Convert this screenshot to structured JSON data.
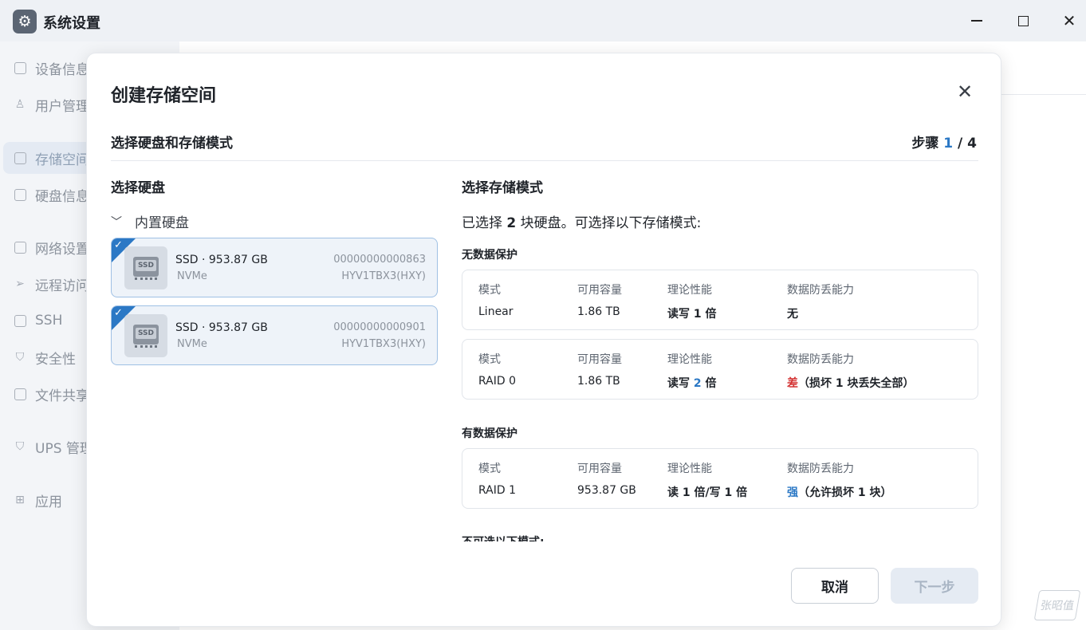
{
  "window": {
    "title": "系统设置",
    "app_icon": "gear-icon",
    "controls": [
      "minimize-icon",
      "maximize-icon",
      "close-icon"
    ]
  },
  "sidebar": {
    "items": [
      {
        "label": "设备信息",
        "icon": "device-icon"
      },
      {
        "label": "用户管理",
        "icon": "user-icon"
      },
      {
        "label": "存储空间",
        "icon": "storage-icon",
        "active": true
      },
      {
        "label": "硬盘信息",
        "icon": "disk-icon"
      },
      {
        "label": "网络设置",
        "icon": "network-icon"
      },
      {
        "label": "远程访问",
        "icon": "send-icon"
      },
      {
        "label": "SSH",
        "icon": "terminal-icon"
      },
      {
        "label": "安全性",
        "icon": "shield-icon"
      },
      {
        "label": "文件共享",
        "icon": "file-icon"
      },
      {
        "label": "UPS 管理",
        "icon": "shield-outline-icon"
      },
      {
        "label": "应用",
        "icon": "apps-grid-icon"
      }
    ]
  },
  "modal": {
    "title": "创建存储空间",
    "step_title": "选择硬盘和存储模式",
    "step_prefix": "步骤 ",
    "step_current": "1",
    "step_suffix": " / 4",
    "left": {
      "heading": "选择硬盘",
      "group_label": "内置硬盘",
      "disks": [
        {
          "name": "SSD · 953.87 GB",
          "type": "NVMe",
          "serial": "00000000000863",
          "model": "HYV1TBX3(HXY)",
          "icon_label": "SSD",
          "selected": true
        },
        {
          "name": "SSD · 953.87 GB",
          "type": "NVMe",
          "serial": "00000000000901",
          "model": "HYV1TBX3(HXY)",
          "icon_label": "SSD",
          "selected": true
        }
      ]
    },
    "right": {
      "heading": "选择存储模式",
      "info_prefix": "已选择 ",
      "info_count": "2",
      "info_suffix": " 块硬盘。可选择以下存储模式:",
      "headers": {
        "mode": "模式",
        "capacity": "可用容量",
        "performance": "理论性能",
        "protection": "数据防丢能力"
      },
      "no_protection_label": "无数据保护",
      "with_protection_label": "有数据保护",
      "unavailable_label": "不可选以下模式:",
      "modes": [
        {
          "mode": "Linear",
          "capacity": "1.86 TB",
          "performance": "读写 1 倍",
          "protection": "无",
          "protection_note": ""
        },
        {
          "mode": "RAID 0",
          "capacity": "1.86 TB",
          "perf_prefix": "读写 ",
          "perf_value": "2",
          "perf_suffix": " 倍",
          "protection": "差",
          "protection_note": "（损坏 1 块丢失全部）"
        },
        {
          "mode": "RAID 1",
          "capacity": "953.87 GB",
          "performance": "读 1 倍/写 1 倍",
          "protection": "强",
          "protection_note": "（允许损坏 1 块）"
        }
      ]
    },
    "buttons": {
      "cancel": "取消",
      "next": "下一步"
    }
  },
  "colors": {
    "accent": "#2b78c5",
    "danger": "#d33131",
    "card_selected_bg": "#eef3f9"
  },
  "watermark": "张昭值"
}
